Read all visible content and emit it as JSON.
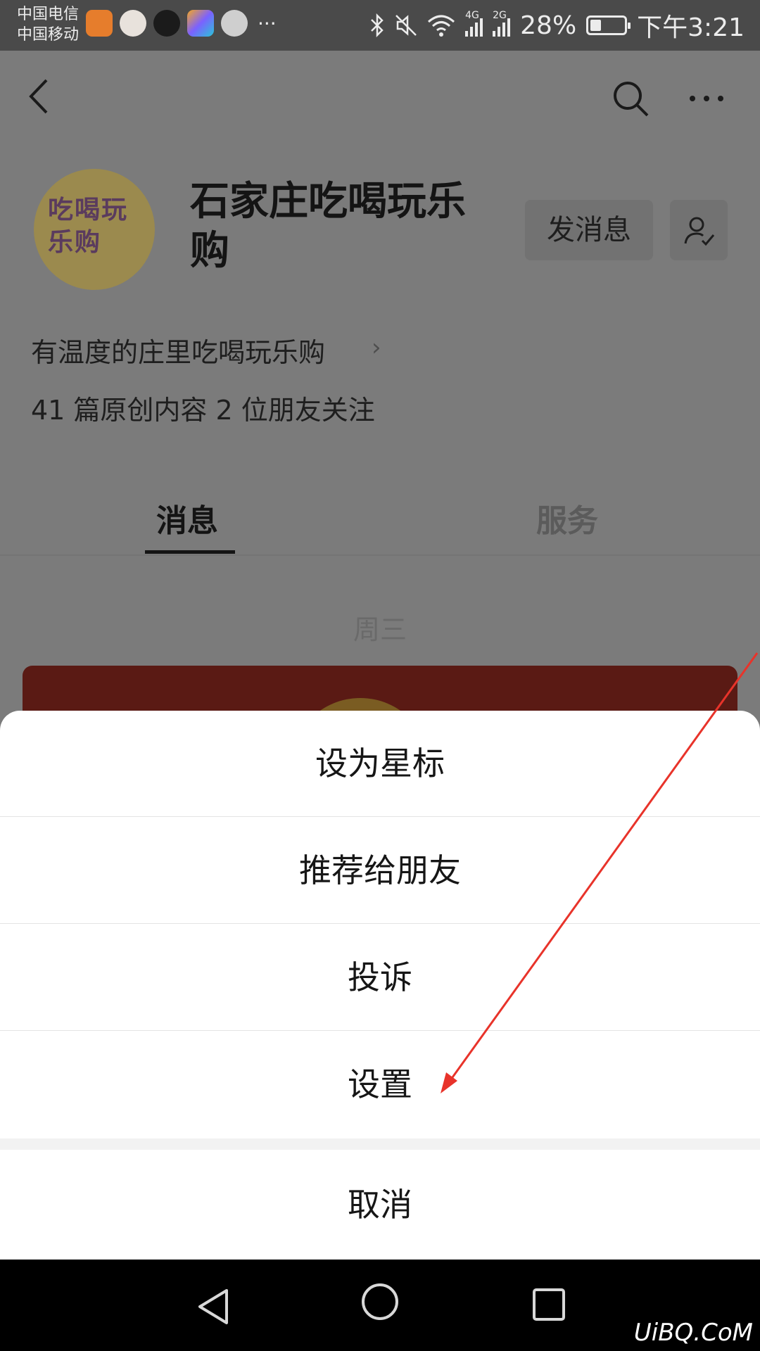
{
  "status_bar": {
    "carrier_1": "中国电信",
    "carrier_2": "中国移动",
    "network_4g": "4G",
    "network_2g": "2G",
    "battery": "28%",
    "time": "下午3:21",
    "more_notifications": "···",
    "icons": [
      "bluetooth-icon",
      "mute-icon",
      "wifi-icon",
      "signal-icon",
      "battery-icon"
    ]
  },
  "header": {
    "back_icon": "back-icon",
    "search_icon": "search-icon",
    "more_icon": "more-icon"
  },
  "profile": {
    "avatar_text": "吃喝玩乐购",
    "name": "石家庄吃喝玩乐购",
    "send_message_label": "发消息",
    "follow_icon": "user-check-icon",
    "description": "有温度的庄里吃喝玩乐购",
    "stats": "41 篇原创内容  2 位朋友关注"
  },
  "tabs": [
    {
      "label": "消息",
      "active": true
    },
    {
      "label": "服务",
      "active": false
    }
  ],
  "feed": {
    "date_label": "周三"
  },
  "action_sheet": {
    "items": [
      {
        "label": "设为星标"
      },
      {
        "label": "推荐给朋友"
      },
      {
        "label": "投诉"
      },
      {
        "label": "设置"
      }
    ],
    "cancel_label": "取消"
  },
  "nav_bar": {
    "icons": [
      "nav-back-icon",
      "nav-home-icon",
      "nav-recent-icon"
    ]
  },
  "watermark": "UiBQ.CoM",
  "colors": {
    "overlay_bg": "#7b7b7b",
    "sheet_bg": "#ffffff",
    "annotation_arrow": "#e8332a",
    "nav_bar_bg": "#000000"
  }
}
